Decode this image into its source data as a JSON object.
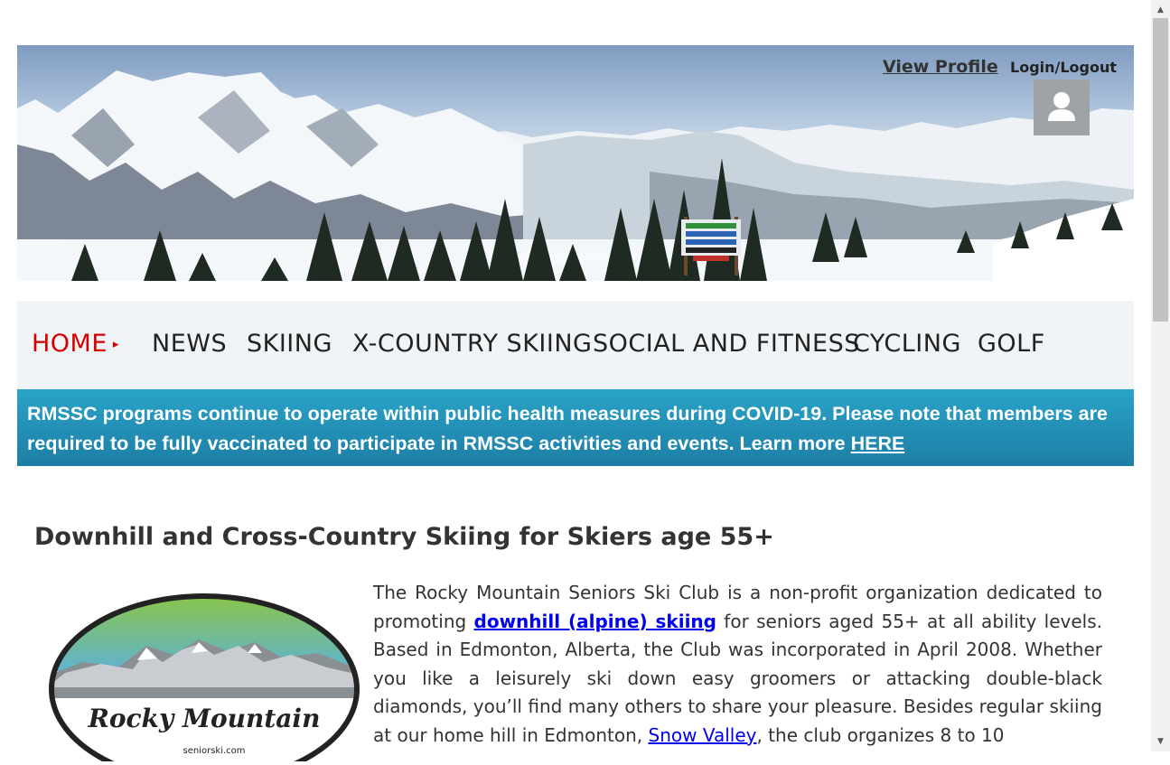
{
  "header": {
    "view_profile": "View Profile",
    "login_logout": "Login/Logout"
  },
  "nav": {
    "items": [
      {
        "label": "HOME",
        "active": true
      },
      {
        "label": "NEWS"
      },
      {
        "label": "SKIING"
      },
      {
        "label": "X-COUNTRY SKIING"
      },
      {
        "label": "SOCIAL AND FITNESS"
      },
      {
        "label": "CYCLING"
      },
      {
        "label": "GOLF"
      }
    ],
    "active_indicator": "▸"
  },
  "notice": {
    "text": "RMSSC programs continue to operate within public health measures during COVID-19. Please note that members are required to be fully vaccinated to participate in RMSSC activities and events. Learn more",
    "link": "HERE"
  },
  "content": {
    "title": "Downhill and Cross-Country Skiing for Skiers age 55+",
    "intro_1": "The Rocky Mountain Seniors Ski Club is a non-profit organization dedicated to promoting",
    "intro_link_1": "downhill (alpine) skiing",
    "intro_2": "for seniors aged 55+ at all ability levels. Based in Edmonton, Alberta, the Club was incorporated in April 2008. Whether you like a leisurely ski down easy groomers or attacking double-black diamonds, you’ll find many others to share your pleasure. Besides regular skiing at our home hill in Edmonton,",
    "intro_link_2": "Snow Valley",
    "intro_3": ", the club organizes 8 to 10"
  },
  "logo": {
    "line1": "Rocky Mountain",
    "site": "seniorski.com"
  },
  "colors": {
    "accent_red": "#d40000",
    "notice_blue": "#1d7ea5",
    "link_blue": "#0000ee"
  }
}
